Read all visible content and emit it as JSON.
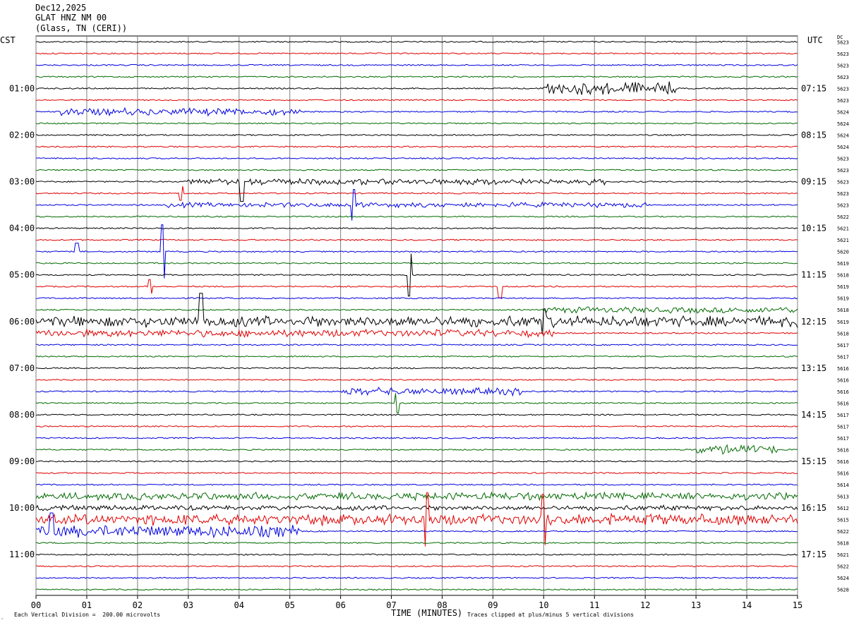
{
  "header": {
    "date": "Dec12,2025",
    "station": "GLAT HNZ NM 00",
    "location": "(Glass, TN (CERI))"
  },
  "left_axis_label": "CST",
  "right_axis_label": "UTC",
  "dc_label": "DC",
  "footer": {
    "left_mark": "‸",
    "scale_note": "Each Vertical Division =  200.00 microvolts",
    "clip_note": "Traces clipped at plus/minus 5 vertical divisions"
  },
  "chart_data": {
    "type": "line",
    "title": "GLAT HNZ NM 00",
    "xlabel": "TIME (MINUTES)",
    "xlim": [
      0,
      15
    ],
    "x_ticks": [
      "00",
      "01",
      "02",
      "03",
      "04",
      "05",
      "06",
      "07",
      "08",
      "09",
      "10",
      "11",
      "12",
      "13",
      "14",
      "15"
    ],
    "rows": 48,
    "trace_colors": [
      "#000000",
      "#e00000",
      "#0000e0",
      "#006a00"
    ],
    "left_time_labels": [
      {
        "row": 4,
        "label": "01:00"
      },
      {
        "row": 8,
        "label": "02:00"
      },
      {
        "row": 12,
        "label": "03:00"
      },
      {
        "row": 16,
        "label": "04:00"
      },
      {
        "row": 20,
        "label": "05:00"
      },
      {
        "row": 24,
        "label": "06:00"
      },
      {
        "row": 28,
        "label": "07:00"
      },
      {
        "row": 32,
        "label": "08:00"
      },
      {
        "row": 36,
        "label": "09:00"
      },
      {
        "row": 40,
        "label": "10:00"
      },
      {
        "row": 44,
        "label": "11:00"
      }
    ],
    "right_time_labels": [
      {
        "row": 4,
        "label": "07:15"
      },
      {
        "row": 8,
        "label": "08:15"
      },
      {
        "row": 12,
        "label": "09:15"
      },
      {
        "row": 16,
        "label": "10:15"
      },
      {
        "row": 20,
        "label": "11:15"
      },
      {
        "row": 24,
        "label": "12:15"
      },
      {
        "row": 28,
        "label": "13:15"
      },
      {
        "row": 32,
        "label": "14:15"
      },
      {
        "row": 36,
        "label": "15:15"
      },
      {
        "row": 40,
        "label": "16:15"
      },
      {
        "row": 44,
        "label": "17:15"
      }
    ],
    "dc_offsets": [
      "5623",
      "5623",
      "5623",
      "5623",
      "5623",
      "5623",
      "5624",
      "5624",
      "5624",
      "5624",
      "5623",
      "5623",
      "5623",
      "5623",
      "5623",
      "5622",
      "5621",
      "5621",
      "5620",
      "5619",
      "5618",
      "5619",
      "5619",
      "5618",
      "5619",
      "5618",
      "5617",
      "5617",
      "5616",
      "5616",
      "5616",
      "5616",
      "5617",
      "5617",
      "5617",
      "5616",
      "5616",
      "5616",
      "5614",
      "5613",
      "5612",
      "5615",
      "5622",
      "5618",
      "5621",
      "5622",
      "5624",
      "5628"
    ],
    "events": [
      {
        "row": 4,
        "from": 10.0,
        "to": 12.6,
        "amp": 10
      },
      {
        "row": 6,
        "from": 0.5,
        "to": 5.2,
        "amp": 6
      },
      {
        "row": 14,
        "from": 2.5,
        "to": 12.0,
        "amp": 4
      },
      {
        "row": 12,
        "from": 3.0,
        "to": 11.2,
        "amp": 5
      },
      {
        "row": 25,
        "from": 0.0,
        "to": 10.2,
        "amp": 6
      },
      {
        "row": 24,
        "from": 0.0,
        "to": 15.0,
        "amp": 9
      },
      {
        "row": 23,
        "from": 10.0,
        "to": 15.0,
        "amp": 5
      },
      {
        "row": 30,
        "from": 6.0,
        "to": 9.6,
        "amp": 6
      },
      {
        "row": 35,
        "from": 13.0,
        "to": 14.6,
        "amp": 8
      },
      {
        "row": 39,
        "from": 0.0,
        "to": 15.0,
        "amp": 6
      },
      {
        "row": 41,
        "from": 0.0,
        "to": 15.0,
        "amp": 9
      },
      {
        "row": 42,
        "from": 0.0,
        "to": 5.2,
        "amp": 10
      },
      {
        "row": 40,
        "from": 0.0,
        "to": 15.0,
        "amp": 4
      }
    ],
    "spikes": [
      {
        "row": 12,
        "x": 4.05,
        "amp": 28
      },
      {
        "row": 13,
        "x": 2.85,
        "amp": 10
      },
      {
        "row": 18,
        "x": 2.5,
        "amp": 38
      },
      {
        "row": 18,
        "x": 0.8,
        "amp": 12
      },
      {
        "row": 20,
        "x": 7.35,
        "amp": 30
      },
      {
        "row": 21,
        "x": 2.25,
        "amp": 10
      },
      {
        "row": 21,
        "x": 9.15,
        "amp": 16
      },
      {
        "row": 24,
        "x": 3.25,
        "amp": 40
      },
      {
        "row": 24,
        "x": 10.0,
        "amp": 18
      },
      {
        "row": 14,
        "x": 6.25,
        "amp": 22
      },
      {
        "row": 31,
        "x": 7.1,
        "amp": 14
      },
      {
        "row": 41,
        "x": 7.7,
        "amp": 38
      },
      {
        "row": 41,
        "x": 10.0,
        "amp": 36
      },
      {
        "row": 42,
        "x": 0.3,
        "amp": 26
      }
    ]
  }
}
